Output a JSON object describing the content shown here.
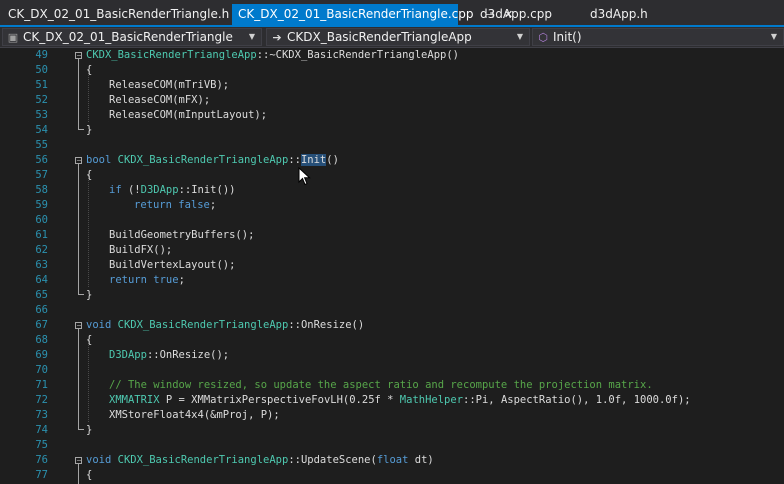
{
  "tabs": [
    {
      "label": "CK_DX_02_01_BasicRenderTriangle.h",
      "active": false
    },
    {
      "label": "CK_DX_02_01_BasicRenderTriangle.cpp",
      "active": true
    },
    {
      "label": "d3dApp.cpp",
      "active": false
    },
    {
      "label": "d3dApp.h",
      "active": false
    }
  ],
  "tab_icons": {
    "pin": "pin-icon",
    "close": "close-icon"
  },
  "navbar": {
    "project": "CK_DX_02_01_BasicRenderTriangle",
    "scope": "CKDX_BasicRenderTriangleApp",
    "member": "Init()"
  },
  "colors": {
    "accent": "#007acc",
    "keyword": "#569cd6",
    "type": "#4ec9b0",
    "comment": "#57a64a",
    "line_number": "#2b91af",
    "selection": "#264f78"
  },
  "line_numbers": [
    "49",
    "50",
    "51",
    "52",
    "53",
    "54",
    "55",
    "56",
    "57",
    "58",
    "59",
    "60",
    "61",
    "62",
    "63",
    "64",
    "65",
    "66",
    "67",
    "68",
    "69",
    "70",
    "71",
    "72",
    "73",
    "74",
    "75",
    "76",
    "77"
  ],
  "code": {
    "l49": {
      "cls": "CKDX_BasicRenderTriangleApp",
      "rest": "::~CKDX_BasicRenderTriangleApp()"
    },
    "l50": "{",
    "l51": "ReleaseCOM(mTriVB);",
    "l52": "ReleaseCOM(mFX);",
    "l53": "ReleaseCOM(mInputLayout);",
    "l54": "}",
    "l56": {
      "kw": "bool",
      "cls": "CKDX_BasicRenderTriangleApp",
      "sep": "::",
      "sel": "Init",
      "rest": "()"
    },
    "l57": "{",
    "l58": {
      "kw": "if",
      "a": " (!",
      "cls": "D3DApp",
      "b": "::Init())"
    },
    "l59": {
      "kw": "return",
      "kw2": "false",
      "end": ";"
    },
    "l61": "BuildGeometryBuffers();",
    "l62": "BuildFX();",
    "l63": "BuildVertexLayout();",
    "l64": {
      "kw": "return",
      "kw2": "true",
      "end": ";"
    },
    "l65": "}",
    "l67": {
      "kw": "void",
      "cls": "CKDX_BasicRenderTriangleApp",
      "rest": "::OnResize()"
    },
    "l68": "{",
    "l69": {
      "cls": "D3DApp",
      "rest": "::OnResize();"
    },
    "l71": "// The window resized, so update the aspect ratio and recompute the projection matrix.",
    "l72": {
      "cls": "XMMATRIX",
      "a": " P = XMMatrixPerspectiveFovLH(0.25f * ",
      "cls2": "MathHelper",
      "b": "::Pi, AspectRatio(), 1.0f, 1000.0f);"
    },
    "l73": "XMStoreFloat4x4(&mProj, P);",
    "l74": "}",
    "l76": {
      "kw": "void",
      "cls": "CKDX_BasicRenderTriangleApp",
      "a": "::UpdateScene(",
      "kw2": "float",
      "b": " dt)"
    },
    "l77": "{"
  }
}
